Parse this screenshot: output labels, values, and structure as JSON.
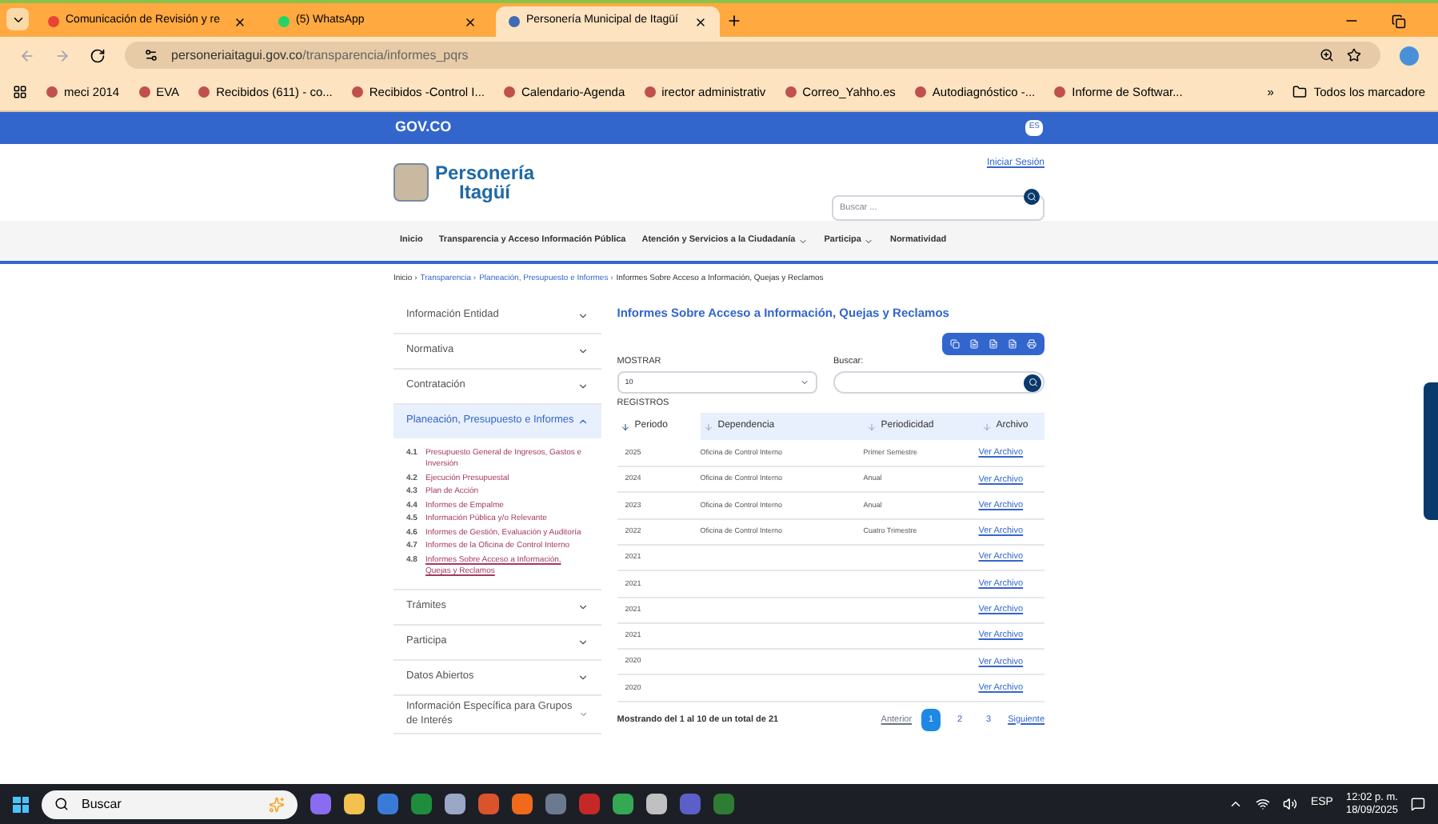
{
  "browser": {
    "tabs": [
      {
        "title": "Comunicación de Revisión y re",
        "selected": false
      },
      {
        "title": "(5) WhatsApp",
        "selected": false
      },
      {
        "title": "Personería Municipal de Itagüí",
        "selected": true
      }
    ],
    "url_host": "personeriaitagui.gov.co",
    "url_path": "/transparencia/informes_pqrs",
    "bookmarks": [
      "meci 2014",
      "EVA",
      "Recibidos (611) - co...",
      "Recibidos -Control I...",
      "Calendario-Agenda",
      "irector administrativ",
      "Correo_Yahho.es",
      "Autodiagnóstico -...",
      "Informe de Softwar..."
    ],
    "more_bookmarks": "»",
    "all_bookmarks": "Todos los marcadore"
  },
  "site": {
    "gov_label": "GOV.CO",
    "lang": "ES",
    "logo_line1": "Personería",
    "logo_line2": "Itagüí",
    "login": "Iniciar Sesión",
    "search_placeholder": "Buscar ...",
    "nav": [
      {
        "label": "Inicio",
        "has_menu": false
      },
      {
        "label": "Transparencia y Acceso Información Pública",
        "has_menu": false
      },
      {
        "label": "Atención y Servicios a la Ciudadanía",
        "has_menu": true
      },
      {
        "label": "Participa",
        "has_menu": true
      },
      {
        "label": "Normatividad",
        "has_menu": false
      }
    ],
    "breadcrumb_separator": "›",
    "breadcrumb": [
      "Inicio",
      "Transparencia",
      "Planeación, Presupuesto e Informes",
      "Informes Sobre Acceso a Información, Quejas y Reclamos"
    ]
  },
  "sidebar": [
    {
      "label": "Información Entidad",
      "expanded": false
    },
    {
      "label": "Normativa",
      "expanded": false
    },
    {
      "label": "Contratación",
      "expanded": false
    },
    {
      "label": "Planeación, Presupuesto e Informes",
      "expanded": true,
      "children": [
        {
          "number": "4.1",
          "label": "Presupuesto General de Ingresos, Gastos e Inversión",
          "selected": false
        },
        {
          "number": "4.2",
          "label": "Ejecución Presupuestal",
          "selected": false
        },
        {
          "number": "4.3",
          "label": "Plan de Acción",
          "selected": false
        },
        {
          "number": "4.4",
          "label": "Informes de Empalme",
          "selected": false
        },
        {
          "number": "4.5",
          "label": "Información Pública y/o Relevante",
          "selected": false
        },
        {
          "number": "4.6",
          "label": "Informes de Gestión, Evaluación y Auditoría",
          "selected": false
        },
        {
          "number": "4.7",
          "label": "Informes de la Oficina de Control Interno",
          "selected": false
        },
        {
          "number": "4.8",
          "label": "Informes Sobre Acceso a Información, Quejas y Reclamos",
          "selected": true
        }
      ]
    },
    {
      "label": "Trámites",
      "expanded": false
    },
    {
      "label": "Participa",
      "expanded": false
    },
    {
      "label": "Datos Abiertos",
      "expanded": false
    },
    {
      "label": "Información Específica para Grupos de Interés",
      "expanded": false
    }
  ],
  "main": {
    "title": "Informes Sobre Acceso a Información, Quejas y Reclamos",
    "show_label": "MOSTRAR",
    "page_size": "10",
    "records_label": "REGISTROS",
    "search_label": "Buscar:",
    "columns": [
      "Periodo",
      "Dependencia",
      "Periodicidad",
      "Archivo"
    ],
    "rows": [
      [
        "2025",
        "Oficina de Control Interno",
        "Primer Semestre",
        "Ver Archivo"
      ],
      [
        "2024",
        "Oficina de Control Interno",
        "Anual",
        "Ver Archivo"
      ],
      [
        "2023",
        "Oficina de Control Interno",
        "Anual",
        "Ver Archivo"
      ],
      [
        "2022",
        "Oficina de Control Interno",
        "Cuatro Trimestre",
        "Ver Archivo"
      ],
      [
        "2021",
        "",
        "",
        "Ver Archivo"
      ],
      [
        "2021",
        "",
        "",
        "Ver Archivo"
      ],
      [
        "2021",
        "",
        "",
        "Ver Archivo"
      ],
      [
        "2021",
        "",
        "",
        "Ver Archivo"
      ],
      [
        "2020",
        "",
        "",
        "Ver Archivo"
      ],
      [
        "2020",
        "",
        "",
        "Ver Archivo"
      ]
    ],
    "summary": "Mostrando del 1 al 10 de un total de 21",
    "prev": "Anterior",
    "pages": [
      {
        "label": "1",
        "selected": true
      },
      {
        "label": "2",
        "selected": false
      },
      {
        "label": "3",
        "selected": false
      }
    ],
    "next": "Siguiente"
  },
  "taskbar": {
    "search": "Buscar",
    "lang": "ESP",
    "time": "12:02 p. m.",
    "date": "18/09/2025"
  }
}
